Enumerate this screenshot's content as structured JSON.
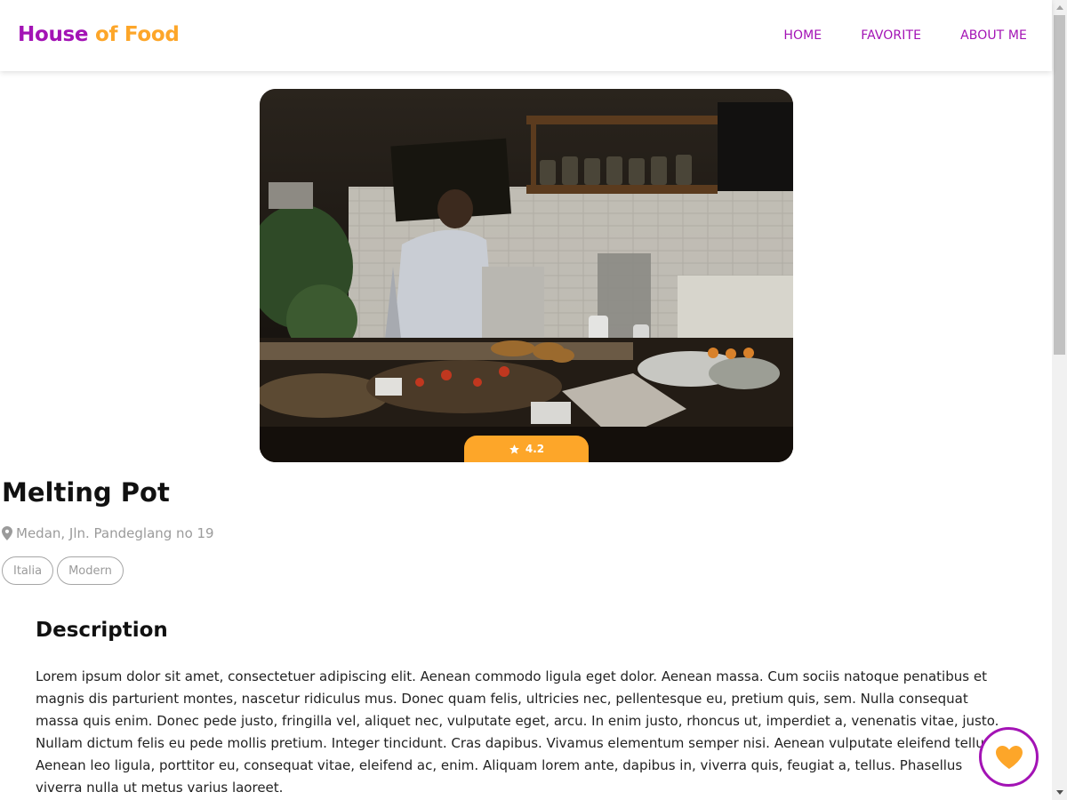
{
  "navbar": {
    "brand_part1": "House",
    "brand_part2": "of Food",
    "links": [
      "HOME",
      "FAVORITE",
      "ABOUT ME"
    ]
  },
  "restaurant": {
    "rating": "4.2",
    "name": "Melting Pot",
    "address": "Medan, Jln. Pandeglang no 19",
    "categories": [
      "Italia",
      "Modern"
    ]
  },
  "description": {
    "heading": "Description",
    "text": "Lorem ipsum dolor sit amet, consectetuer adipiscing elit. Aenean commodo ligula eget dolor. Aenean massa. Cum sociis natoque penatibus et magnis dis parturient montes, nascetur ridiculus mus. Donec quam felis, ultricies nec, pellentesque eu, pretium quis, sem. Nulla consequat massa quis enim. Donec pede justo, fringilla vel, aliquet nec, vulputate eget, arcu. In enim justo, rhoncus ut, imperdiet a, venenatis vitae, justo. Nullam dictum felis eu pede mollis pretium. Integer tincidunt. Cras dapibus. Vivamus elementum semper nisi. Aenean vulputate eleifend tellus. Aenean leo ligula, porttitor eu, consequat vitae, eleifend ac, enim. Aliquam lorem ante, dapibus in, viverra quis, feugiat a, tellus. Phasellus viverra nulla ut metus varius laoreet."
  },
  "icons": {
    "location": "map-marker-icon",
    "rating": "star-icon",
    "favorite": "heart-icon"
  },
  "colors": {
    "primary": "#a313b5",
    "accent": "#fda629",
    "muted": "#9b9b9b"
  }
}
